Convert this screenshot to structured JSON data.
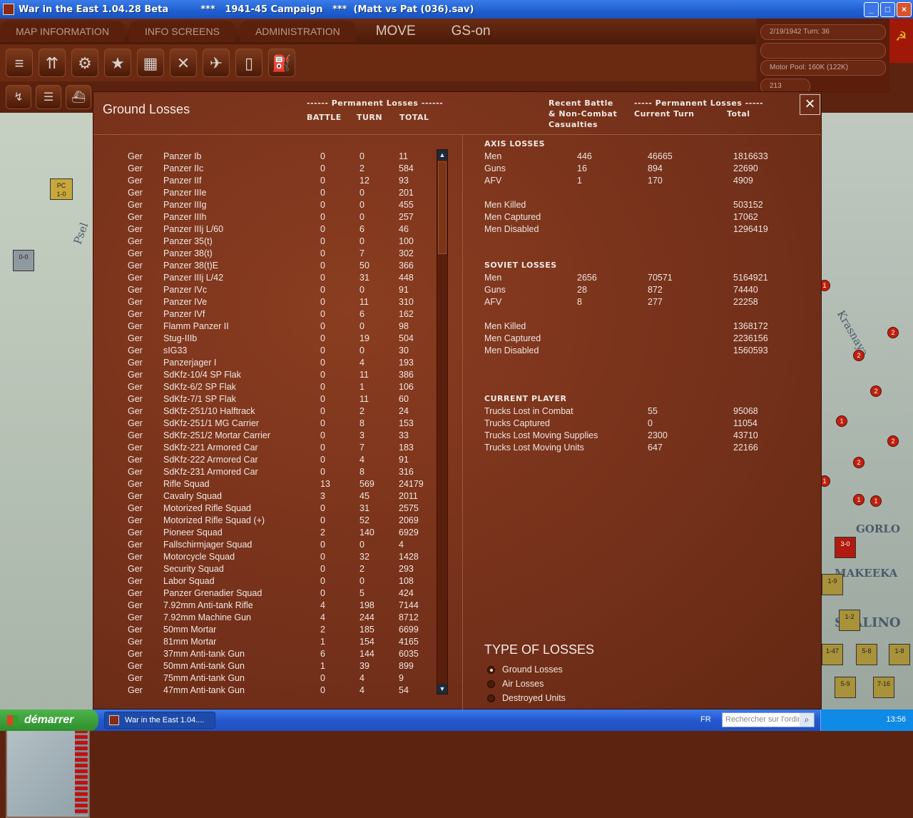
{
  "window": {
    "title": "War in the East 1.04.28 Beta          ***   1941-45 Campaign   ***  (Matt vs Pat (036).sav)"
  },
  "menu": {
    "map_information": "MAP INFORMATION",
    "info_screens": "INFO SCREENS",
    "administration": "ADMINISTRATION",
    "move": "MOVE",
    "gs_on": "GS-on"
  },
  "info": {
    "date_turn": "2/19/1942    Turn: 36",
    "motor_pool": "Motor Pool: 160K (122K)",
    "value": "213"
  },
  "dialog": {
    "title": "Ground Losses",
    "left_header_group": "------ Permanent Losses ------",
    "col_battle": "BATTLE",
    "col_turn": "TURN",
    "col_total": "TOTAL",
    "recent_header": "Recent Battle\n& Non-Combat\nCasualties",
    "right_header_group": "----- Permanent Losses -----",
    "col_current_turn": "Current Turn",
    "col_total_right": "Total",
    "close": "×"
  },
  "losses": [
    {
      "nat": "Ger",
      "name": "Panzer Ib",
      "battle": "0",
      "turn": "0",
      "total": "11"
    },
    {
      "nat": "Ger",
      "name": "Panzer IIc",
      "battle": "0",
      "turn": "2",
      "total": "584"
    },
    {
      "nat": "Ger",
      "name": "Panzer IIf",
      "battle": "0",
      "turn": "12",
      "total": "93"
    },
    {
      "nat": "Ger",
      "name": "Panzer IIIe",
      "battle": "0",
      "turn": "0",
      "total": "201"
    },
    {
      "nat": "Ger",
      "name": "Panzer IIIg",
      "battle": "0",
      "turn": "0",
      "total": "455"
    },
    {
      "nat": "Ger",
      "name": "Panzer IIIh",
      "battle": "0",
      "turn": "0",
      "total": "257"
    },
    {
      "nat": "Ger",
      "name": "Panzer IIIj L/60",
      "battle": "0",
      "turn": "6",
      "total": "46"
    },
    {
      "nat": "Ger",
      "name": "Panzer 35(t)",
      "battle": "0",
      "turn": "0",
      "total": "100"
    },
    {
      "nat": "Ger",
      "name": "Panzer 38(t)",
      "battle": "0",
      "turn": "7",
      "total": "302"
    },
    {
      "nat": "Ger",
      "name": "Panzer 38(t)E",
      "battle": "0",
      "turn": "50",
      "total": "366"
    },
    {
      "nat": "Ger",
      "name": "Panzer IIIj L/42",
      "battle": "0",
      "turn": "31",
      "total": "448"
    },
    {
      "nat": "Ger",
      "name": "Panzer IVc",
      "battle": "0",
      "turn": "0",
      "total": "91"
    },
    {
      "nat": "Ger",
      "name": "Panzer IVe",
      "battle": "0",
      "turn": "11",
      "total": "310"
    },
    {
      "nat": "Ger",
      "name": "Panzer IVf",
      "battle": "0",
      "turn": "6",
      "total": "162"
    },
    {
      "nat": "Ger",
      "name": "Flamm Panzer II",
      "battle": "0",
      "turn": "0",
      "total": "98"
    },
    {
      "nat": "Ger",
      "name": "Stug-IIIb",
      "battle": "0",
      "turn": "19",
      "total": "504"
    },
    {
      "nat": "Ger",
      "name": "sIG33",
      "battle": "0",
      "turn": "0",
      "total": "30"
    },
    {
      "nat": "Ger",
      "name": "Panzerjager I",
      "battle": "0",
      "turn": "4",
      "total": "193"
    },
    {
      "nat": "Ger",
      "name": "SdKfz-10/4 SP Flak",
      "battle": "0",
      "turn": "11",
      "total": "386"
    },
    {
      "nat": "Ger",
      "name": "SdKfz-6/2 SP Flak",
      "battle": "0",
      "turn": "1",
      "total": "106"
    },
    {
      "nat": "Ger",
      "name": "SdKfz-7/1 SP Flak",
      "battle": "0",
      "turn": "11",
      "total": "60"
    },
    {
      "nat": "Ger",
      "name": "SdKfz-251/10 Halftrack",
      "battle": "0",
      "turn": "2",
      "total": "24"
    },
    {
      "nat": "Ger",
      "name": "SdKfz-251/1 MG Carrier",
      "battle": "0",
      "turn": "8",
      "total": "153"
    },
    {
      "nat": "Ger",
      "name": "SdKfz-251/2 Mortar Carrier",
      "battle": "0",
      "turn": "3",
      "total": "33"
    },
    {
      "nat": "Ger",
      "name": "SdKfz-221 Armored Car",
      "battle": "0",
      "turn": "7",
      "total": "183"
    },
    {
      "nat": "Ger",
      "name": "SdKfz-222 Armored Car",
      "battle": "0",
      "turn": "4",
      "total": "91"
    },
    {
      "nat": "Ger",
      "name": "SdKfz-231 Armored Car",
      "battle": "0",
      "turn": "8",
      "total": "316"
    },
    {
      "nat": "Ger",
      "name": "Rifle Squad",
      "battle": "13",
      "turn": "569",
      "total": "24179"
    },
    {
      "nat": "Ger",
      "name": "Cavalry Squad",
      "battle": "3",
      "turn": "45",
      "total": "2011"
    },
    {
      "nat": "Ger",
      "name": "Motorized Rifle Squad",
      "battle": "0",
      "turn": "31",
      "total": "2575"
    },
    {
      "nat": "Ger",
      "name": "Motorized Rifle Squad (+)",
      "battle": "0",
      "turn": "52",
      "total": "2069"
    },
    {
      "nat": "Ger",
      "name": "Pioneer Squad",
      "battle": "2",
      "turn": "140",
      "total": "6929"
    },
    {
      "nat": "Ger",
      "name": "Fallschirmjager Squad",
      "battle": "0",
      "turn": "0",
      "total": "4"
    },
    {
      "nat": "Ger",
      "name": "Motorcycle Squad",
      "battle": "0",
      "turn": "32",
      "total": "1428"
    },
    {
      "nat": "Ger",
      "name": "Security Squad",
      "battle": "0",
      "turn": "2",
      "total": "293"
    },
    {
      "nat": "Ger",
      "name": "Labor Squad",
      "battle": "0",
      "turn": "0",
      "total": "108"
    },
    {
      "nat": "Ger",
      "name": "Panzer Grenadier Squad",
      "battle": "0",
      "turn": "5",
      "total": "424"
    },
    {
      "nat": "Ger",
      "name": "7.92mm Anti-tank Rifle",
      "battle": "4",
      "turn": "198",
      "total": "7144"
    },
    {
      "nat": "Ger",
      "name": "7.92mm Machine Gun",
      "battle": "4",
      "turn": "244",
      "total": "8712"
    },
    {
      "nat": "Ger",
      "name": "50mm Mortar",
      "battle": "2",
      "turn": "185",
      "total": "6699"
    },
    {
      "nat": "Ger",
      "name": "81mm Mortar",
      "battle": "1",
      "turn": "154",
      "total": "4165"
    },
    {
      "nat": "Ger",
      "name": "37mm Anti-tank Gun",
      "battle": "6",
      "turn": "144",
      "total": "6035"
    },
    {
      "nat": "Ger",
      "name": "50mm Anti-tank Gun",
      "battle": "1",
      "turn": "39",
      "total": "899"
    },
    {
      "nat": "Ger",
      "name": "75mm Anti-tank Gun",
      "battle": "0",
      "turn": "4",
      "total": "9"
    },
    {
      "nat": "Ger",
      "name": "47mm Anti-tank Gun",
      "battle": "0",
      "turn": "4",
      "total": "54"
    }
  ],
  "axis": {
    "header": "AXIS LOSSES",
    "rows": [
      {
        "label": "Men",
        "recent": "446",
        "turn": "46665",
        "total": "1816633"
      },
      {
        "label": "Guns",
        "recent": "16",
        "turn": "894",
        "total": "22690"
      },
      {
        "label": "AFV",
        "recent": "1",
        "turn": "170",
        "total": "4909"
      }
    ],
    "killed": {
      "label": "Men Killed",
      "total": "503152"
    },
    "captured": {
      "label": "Men Captured",
      "total": "17062"
    },
    "disabled": {
      "label": "Men Disabled",
      "total": "1296419"
    }
  },
  "soviet": {
    "header": "SOVIET LOSSES",
    "rows": [
      {
        "label": "Men",
        "recent": "2656",
        "turn": "70571",
        "total": "5164921"
      },
      {
        "label": "Guns",
        "recent": "28",
        "turn": "872",
        "total": "74440"
      },
      {
        "label": "AFV",
        "recent": "8",
        "turn": "277",
        "total": "22258"
      }
    ],
    "killed": {
      "label": "Men Killed",
      "total": "1368172"
    },
    "captured": {
      "label": "Men Captured",
      "total": "2236156"
    },
    "disabled": {
      "label": "Men Disabled",
      "total": "1560593"
    }
  },
  "current_player": {
    "header": "CURRENT PLAYER",
    "rows": [
      {
        "label": "Trucks Lost in Combat",
        "turn": "55",
        "total": "95068"
      },
      {
        "label": "Trucks Captured",
        "turn": "0",
        "total": "11054"
      },
      {
        "label": "Trucks Lost Moving Supplies",
        "turn": "2300",
        "total": "43710"
      },
      {
        "label": "Trucks Lost Moving Units",
        "turn": "647",
        "total": "22166"
      }
    ]
  },
  "type_of_losses": {
    "header": "TYPE OF LOSSES",
    "options": [
      "Ground Losses",
      "Air Losses",
      "Destroyed Units"
    ],
    "selected": "Ground Losses"
  },
  "map": {
    "labels": [
      "Psel",
      "Krasnaya",
      "GORLO",
      "MAKEEKA",
      "STALINO"
    ],
    "units": [
      {
        "label": "PC\n1-0"
      },
      {
        "label": "0-0"
      },
      {
        "label": "3-0"
      },
      {
        "label": "1-9"
      },
      {
        "label": "1-2"
      },
      {
        "label": "1-47"
      },
      {
        "label": "5-8"
      },
      {
        "label": "1-8"
      },
      {
        "label": "5-9"
      },
      {
        "label": "7-16"
      }
    ]
  },
  "taskbar": {
    "start": "démarrer",
    "task": "War in the East 1.04....",
    "lang": "FR",
    "search_placeholder": "Rechercher sur l'ordin",
    "clock": "13:56"
  }
}
